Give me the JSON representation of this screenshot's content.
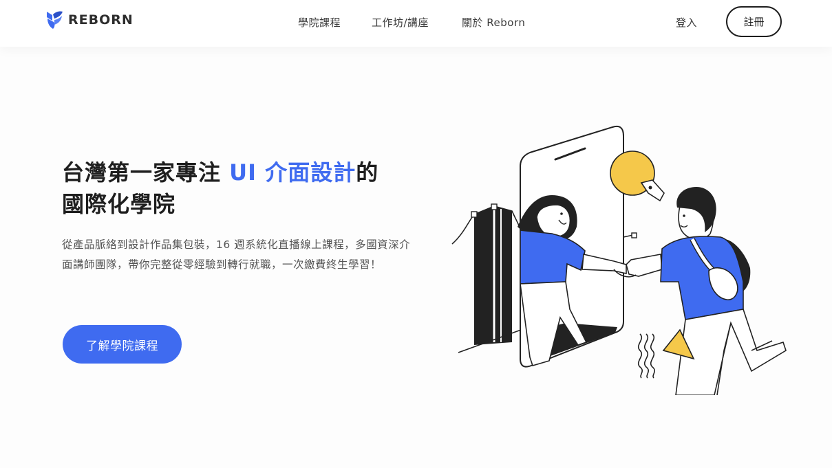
{
  "header": {
    "logo_text": "REBORN",
    "nav": [
      {
        "label": "學院課程"
      },
      {
        "label": "工作坊/講座"
      },
      {
        "label": "關於 Reborn"
      }
    ],
    "login_label": "登入",
    "signup_label": "註冊"
  },
  "hero": {
    "headline_part1": "台灣第一家專注 ",
    "headline_accent": "UI 介面設計",
    "headline_part2": "的",
    "headline_line2": "國際化學院",
    "description": "從產品脈絡到設計作品集包裝，16 週系統化直播線上課程，多國資深介面講師團隊，帶你完整從零經驗到轉行就職，一次繳費終生學習！",
    "cta_label": "了解學院課程"
  },
  "colors": {
    "accent": "#3f6bf0",
    "yellow": "#f5c84a",
    "dark": "#1e1e1e"
  },
  "icons": [
    "reborn-logo-icon"
  ]
}
